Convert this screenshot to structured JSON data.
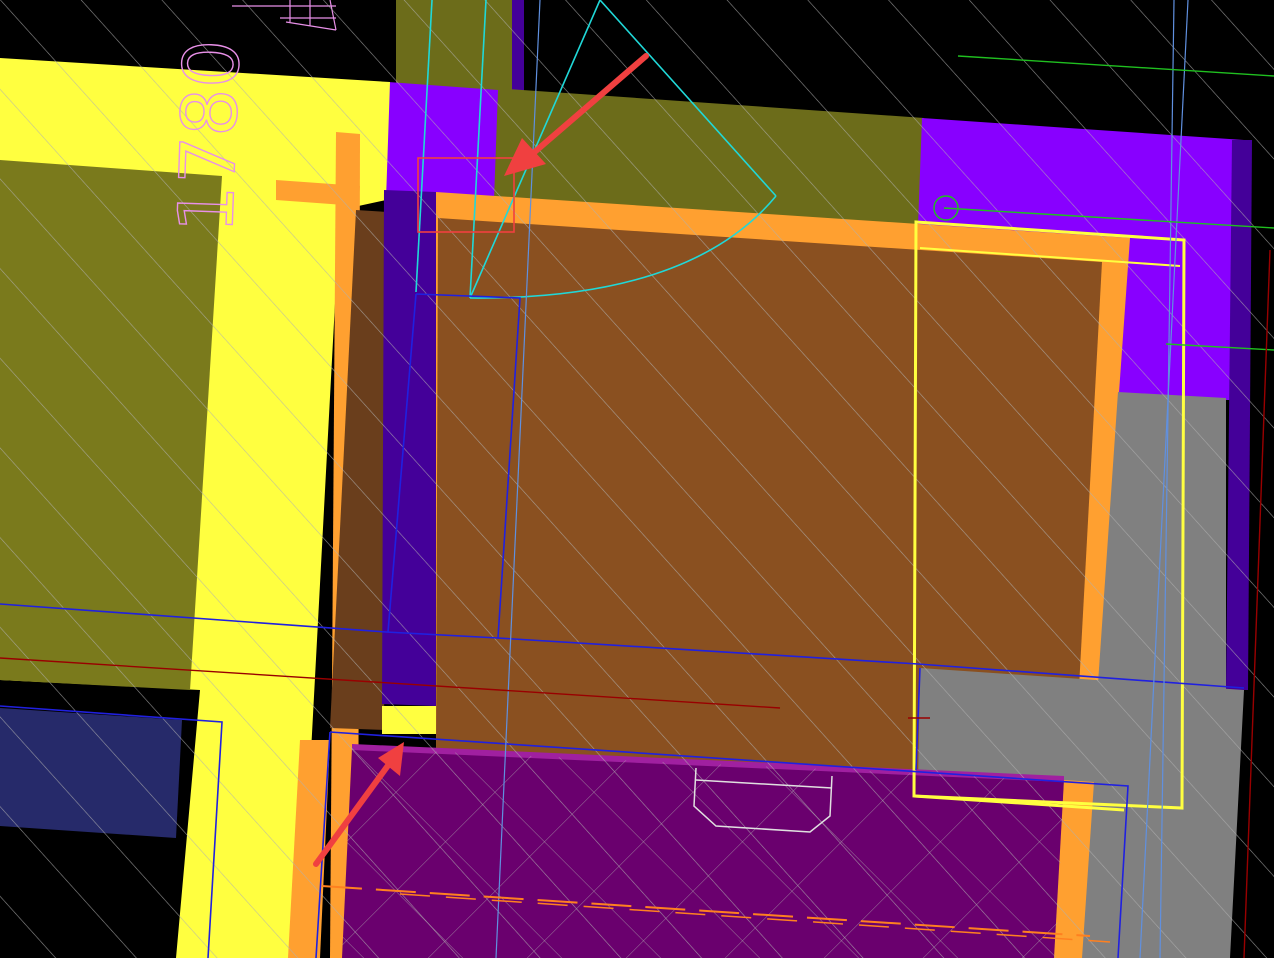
{
  "drawing": {
    "dimension_text": "1780",
    "colors": {
      "background": "#000000",
      "wall_yellow": "#FFFF40",
      "olive_fill": "#7A7A1C",
      "olive_dark": "#6C6C1A",
      "brown_fill": "#8A5020",
      "brown_dark": "#6A3E1C",
      "orange_edge": "#FFA030",
      "violet": "#8800FF",
      "deep_violet": "#440099",
      "purple_slab": "#6A006E",
      "gray": "#808080",
      "navy": "#262A6A",
      "hatch": "#B0B0B0",
      "blue_line": "#2020E0",
      "cyan_line": "#20D8D8",
      "arrow_red": "#F04040",
      "dimension_pink": "#E890E8",
      "green_line": "#20C020",
      "dark_red_line": "#990000"
    }
  }
}
